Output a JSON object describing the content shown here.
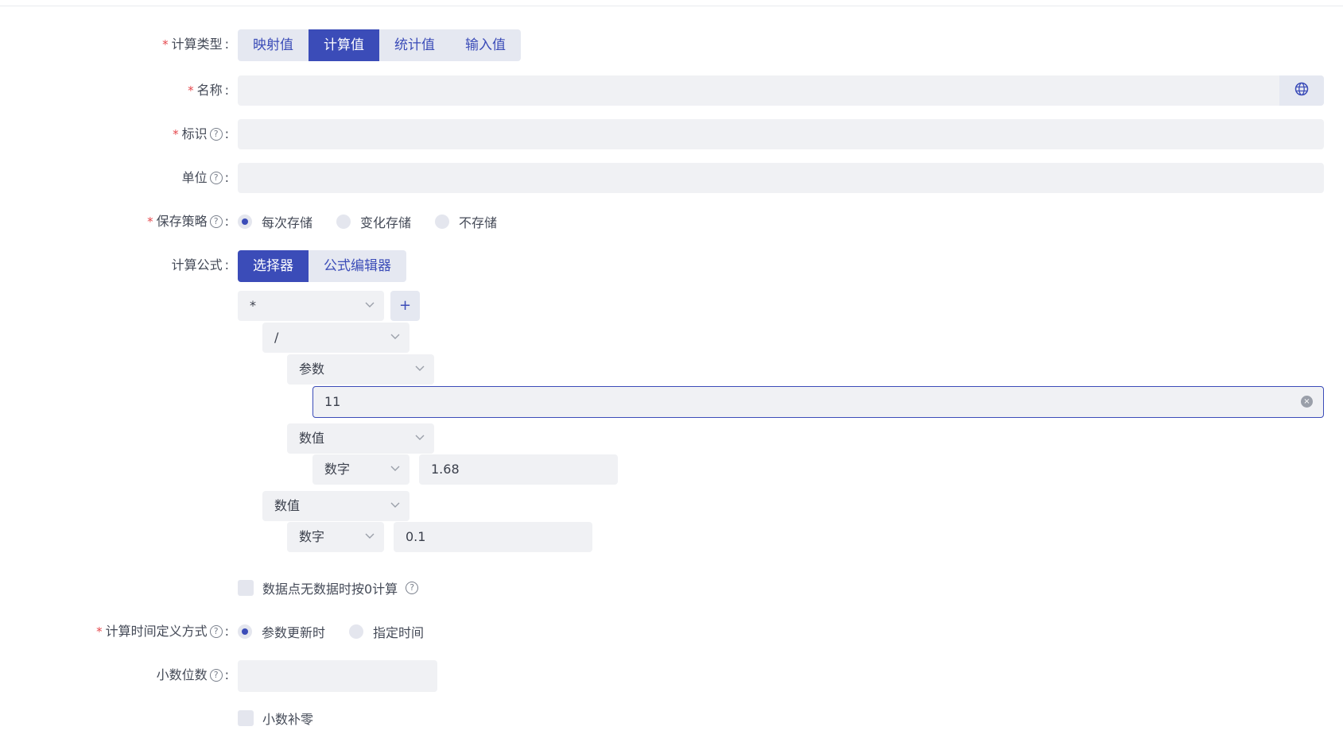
{
  "form": {
    "calc_type": {
      "label": "计算类型",
      "options": [
        "映射值",
        "计算值",
        "统计值",
        "输入值"
      ],
      "selected": "计算值"
    },
    "name": {
      "label": "名称",
      "value": "",
      "icon": "globe-icon"
    },
    "identifier": {
      "label": "标识",
      "value": ""
    },
    "unit": {
      "label": "单位",
      "value": ""
    },
    "save_policy": {
      "label": "保存策略",
      "options": [
        "每次存储",
        "变化存储",
        "不存储"
      ],
      "selected": "每次存储"
    },
    "formula": {
      "label": "计算公式",
      "tabs": [
        "选择器",
        "公式编辑器"
      ],
      "selected": "选择器",
      "tree": {
        "root_operator": "*",
        "add_label": "+",
        "child_operator": "/",
        "param_type": "参数",
        "param_value": "11",
        "value_type_1": "数值",
        "number_type_1": "数字",
        "number_value_1": "1.68",
        "value_type_2": "数值",
        "number_type_2": "数字",
        "number_value_2": "0.1"
      }
    },
    "zero_when_no_data": {
      "label": "数据点无数据时按0计算",
      "checked": false
    },
    "time_definition": {
      "label": "计算时间定义方式",
      "options": [
        "参数更新时",
        "指定时间"
      ],
      "selected": "参数更新时"
    },
    "decimals": {
      "label": "小数位数",
      "value": ""
    },
    "pad_zero": {
      "label": "小数补零",
      "checked": false
    }
  },
  "colors": {
    "primary": "#3b4cb8",
    "required": "#e5484d",
    "field_bg": "#f0f1f4"
  }
}
